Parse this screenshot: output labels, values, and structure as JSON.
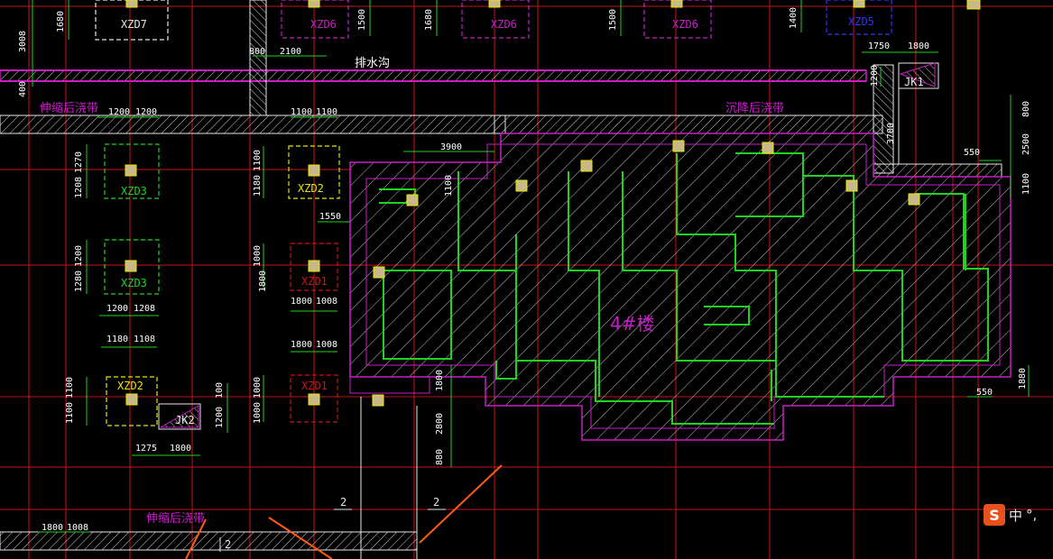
{
  "colors": {
    "background": "#000000",
    "axis_red": "#c81414",
    "magenta": "#c81ec8",
    "green": "#21d221",
    "yellow": "#e6e600",
    "blue": "#3232ff",
    "white": "#e6e6e6",
    "hatch": "#bfbfbf",
    "dim_text": "#ffffff",
    "orange_leader": "#ff5a14"
  },
  "labels": {
    "drain_ditch": "排水沟",
    "exp_band_top": "伸缩后浇带",
    "settle_band": "沉降后浇带",
    "exp_band_bottom": "伸缩后浇带",
    "building": "4#楼",
    "section_2a": "2",
    "section_2b": "2",
    "section_2c": "2"
  },
  "foundations": {
    "xzd7": "XZD7",
    "xzd6_a": "XZD6",
    "xzd6_b": "XZD6",
    "xzd6_c": "XZD6",
    "xzd5": "XZD5",
    "xzd3_a": "XZD3",
    "xzd2_a": "XZD2",
    "xzd3_b": "XZD3",
    "xzd1_a": "XZD1",
    "xzd2_b": "XZD2",
    "xzd1_b": "XZD1",
    "jk1": "JK1",
    "jk2": "JK2"
  },
  "dims": {
    "d3008": "3008",
    "d1680": "1680",
    "d1500a": "1500",
    "d1680b": "1680",
    "d1500b": "1500",
    "d1400": "1400",
    "d800a": "800",
    "d2100": "2100",
    "d400": "400",
    "d1750": "1750",
    "d1800a": "1800",
    "d1200v": "1200",
    "d1200a": "1200",
    "d1200b": "1200",
    "d1100a": "1100",
    "d1100b": "1100",
    "d3900": "3900",
    "d3700": "3700",
    "d800b": "800",
    "d2500": "2500",
    "d1100c": "1100",
    "d550a": "550",
    "d1270": "1270",
    "d1208": "1208",
    "d1100d": "1100",
    "d1180": "1180",
    "d1100e": "1100",
    "d1550": "1550",
    "d1200c": "1200",
    "d1280": "1280",
    "d1000a": "1000",
    "d1800b": "1800",
    "d1800c": "1800",
    "d1008a": "1008",
    "d1200d": "1200",
    "d1208b": "1208",
    "d1180b": "1180",
    "d1108": "1108",
    "d1800d": "1800",
    "d1008b": "1008",
    "d1100f": "1100",
    "d1100g": "1100",
    "d1000b": "1000",
    "d1000c": "1000",
    "d1200e": "1200",
    "d100": "100",
    "d1275": "1275",
    "d1800e": "1800",
    "d1800f": "1800",
    "d2800": "2800",
    "d880": "880",
    "d550b": "550",
    "d1880": "1880",
    "d1800g": "1800",
    "d1008c": "1008"
  },
  "ime": {
    "logo": "S",
    "mode": "中",
    "punct": "°,"
  }
}
